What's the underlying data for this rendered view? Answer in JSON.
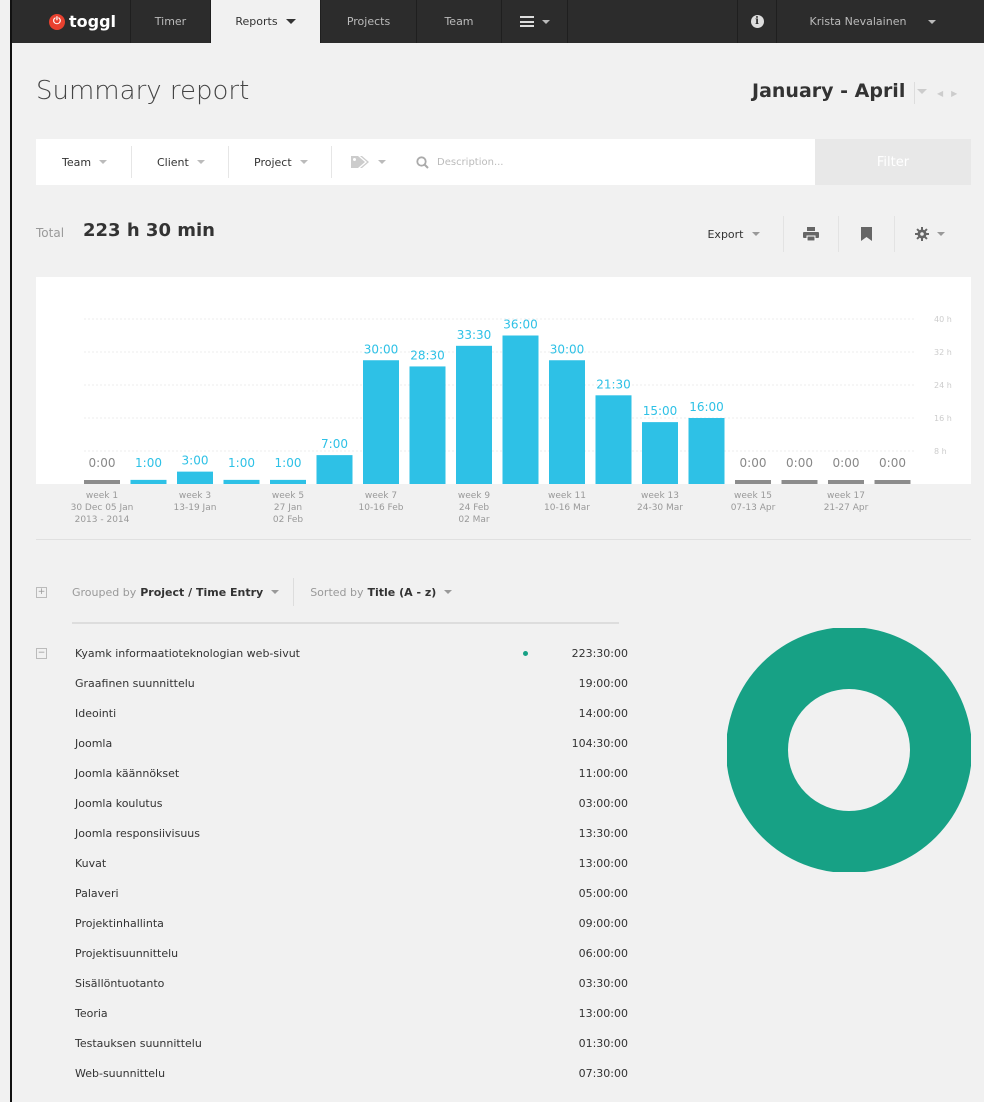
{
  "nav": {
    "logo": "toggl",
    "timer": "Timer",
    "reports": "Reports",
    "projects": "Projects",
    "team": "Team",
    "user": "Krista Nevalainen"
  },
  "title": "Summary report",
  "date_range": "January - April",
  "filters": {
    "team": "Team",
    "client": "Client",
    "project": "Project",
    "description_placeholder": "Description...",
    "filter_button": "Filter"
  },
  "total": {
    "label": "Total",
    "value": "223 h 30 min"
  },
  "toolbar": {
    "export": "Export"
  },
  "colors": {
    "bar": "#2ec1e6",
    "empty_bar": "#8c8c8c",
    "donut": "#17a185",
    "brand": "#e8412f"
  },
  "chart_data": {
    "type": "bar",
    "unit": "hours",
    "y_ticks": [
      "8 h",
      "16 h",
      "24 h",
      "32 h",
      "40 h"
    ],
    "ylim": [
      0,
      40
    ],
    "bar_labels": [
      "0:00",
      "1:00",
      "3:00",
      "1:00",
      "1:00",
      "7:00",
      "30:00",
      "28:30",
      "33:30",
      "36:00",
      "30:00",
      "21:30",
      "15:00",
      "16:00",
      "0:00",
      "0:00",
      "0:00",
      "0:00"
    ],
    "values": [
      0,
      1,
      3,
      1,
      1,
      7,
      30,
      28.5,
      33.5,
      36,
      30,
      21.5,
      15,
      16,
      0,
      0,
      0,
      0
    ],
    "x_labels": [
      {
        "bar": 0,
        "lines": [
          "week 1",
          "30 Dec 05 Jan",
          "2013 - 2014"
        ]
      },
      {
        "bar": 2,
        "lines": [
          "week 3",
          "13-19 Jan"
        ]
      },
      {
        "bar": 4,
        "lines": [
          "week 5",
          "27 Jan",
          "02 Feb"
        ]
      },
      {
        "bar": 6,
        "lines": [
          "week 7",
          "10-16 Feb"
        ]
      },
      {
        "bar": 8,
        "lines": [
          "week 9",
          "24 Feb",
          "02 Mar"
        ]
      },
      {
        "bar": 10,
        "lines": [
          "week 11",
          "10-16 Mar"
        ]
      },
      {
        "bar": 12,
        "lines": [
          "week 13",
          "24-30 Mar"
        ]
      },
      {
        "bar": 14,
        "lines": [
          "week 15",
          "07-13 Apr"
        ]
      },
      {
        "bar": 16,
        "lines": [
          "week 17",
          "21-27 Apr"
        ]
      }
    ]
  },
  "grouping": {
    "grouped_prefix": "Grouped by",
    "grouped_value": "Project / Time Entry",
    "sorted_prefix": "Sorted by",
    "sorted_value": "Title (A - z)"
  },
  "project": {
    "name": "Kyamk informaatioteknologian web-sivut",
    "total": "223:30:00"
  },
  "entries": [
    {
      "title": "Graafinen suunnittelu",
      "time": "19:00:00"
    },
    {
      "title": "Ideointi",
      "time": "14:00:00"
    },
    {
      "title": "Joomla",
      "time": "104:30:00"
    },
    {
      "title": "Joomla käännökset",
      "time": "11:00:00"
    },
    {
      "title": "Joomla koulutus",
      "time": "03:00:00"
    },
    {
      "title": "Joomla responsiivisuus",
      "time": "13:30:00"
    },
    {
      "title": "Kuvat",
      "time": "13:00:00"
    },
    {
      "title": "Palaveri",
      "time": "05:00:00"
    },
    {
      "title": "Projektinhallinta",
      "time": "09:00:00"
    },
    {
      "title": "Projektisuunnittelu",
      "time": "06:00:00"
    },
    {
      "title": "Sisällöntuotanto",
      "time": "03:30:00"
    },
    {
      "title": "Teoria",
      "time": "13:00:00"
    },
    {
      "title": "Testauksen suunnittelu",
      "time": "01:30:00"
    },
    {
      "title": "Web-suunnittelu",
      "time": "07:30:00"
    }
  ]
}
